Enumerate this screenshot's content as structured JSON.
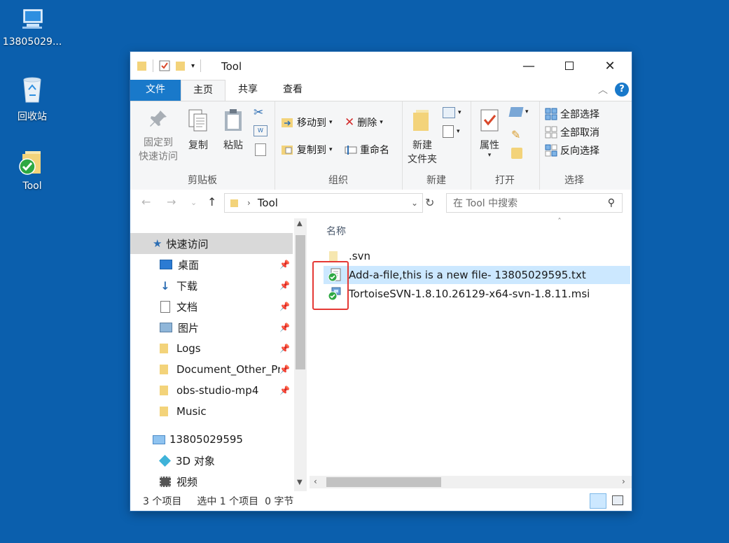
{
  "desktop": {
    "icons": [
      {
        "label": "13805029...",
        "icon": "computer-icon"
      },
      {
        "label": "回收站",
        "icon": "recycle-bin-icon"
      },
      {
        "label": "Tool",
        "icon": "folder-svn-icon"
      }
    ]
  },
  "window": {
    "title": "Tool",
    "tabs": [
      {
        "label": "文件",
        "state": "file"
      },
      {
        "label": "主页",
        "state": "active"
      },
      {
        "label": "共享",
        "state": "normal"
      },
      {
        "label": "查看",
        "state": "normal"
      }
    ],
    "ribbon": {
      "clipboard": {
        "group_label": "剪贴板",
        "pin_label_1": "固定到",
        "pin_label_2": "快速访问",
        "copy": "复制",
        "paste": "粘贴"
      },
      "organize": {
        "group_label": "组织",
        "move_to": "移动到",
        "copy_to": "复制到",
        "delete": "删除",
        "rename": "重命名"
      },
      "new": {
        "group_label": "新建",
        "new_folder_1": "新建",
        "new_folder_2": "文件夹"
      },
      "open": {
        "group_label": "打开",
        "properties": "属性"
      },
      "select": {
        "group_label": "选择",
        "select_all": "全部选择",
        "select_none": "全部取消",
        "invert": "反向选择"
      }
    },
    "address": {
      "path": "Tool",
      "search_placeholder": "在 Tool 中搜索"
    },
    "nav_pane": {
      "quick_access": "快速访问",
      "items": [
        {
          "label": "桌面",
          "icon": "desktop-icon",
          "pinned": true
        },
        {
          "label": "下载",
          "icon": "download-icon",
          "pinned": true
        },
        {
          "label": "文档",
          "icon": "document-icon",
          "pinned": true
        },
        {
          "label": "图片",
          "icon": "pictures-icon",
          "pinned": true
        },
        {
          "label": "Logs",
          "icon": "folder-icon",
          "pinned": true
        },
        {
          "label": "Document_Other_Pr",
          "icon": "folder-icon",
          "pinned": true
        },
        {
          "label": "obs-studio-mp4",
          "icon": "folder-icon",
          "pinned": true
        },
        {
          "label": "Music",
          "icon": "folder-icon",
          "pinned": false
        }
      ],
      "this_pc": "13805029595",
      "pc_items": [
        {
          "label": "3D 对象",
          "icon": "3d-objects-icon"
        },
        {
          "label": "视频",
          "icon": "video-icon"
        }
      ]
    },
    "content": {
      "column_name": "名称",
      "files": [
        {
          "name": ".svn",
          "icon": "folder-icon",
          "selected": false
        },
        {
          "name": "Add-a-file,this is a new file- 13805029595.txt",
          "icon": "svn-text-file-icon",
          "selected": true
        },
        {
          "name": "TortoiseSVN-1.8.10.26129-x64-svn-1.8.11.msi",
          "icon": "svn-installer-icon",
          "selected": false
        }
      ]
    },
    "status": {
      "count": "3 个项目",
      "selection": "选中 1 个项目  0 字节"
    }
  },
  "colors": {
    "desktop_bg": "#0b5fad",
    "file_tab": "#1979ca",
    "selection": "#cce8ff",
    "annotation": "#e53935"
  }
}
